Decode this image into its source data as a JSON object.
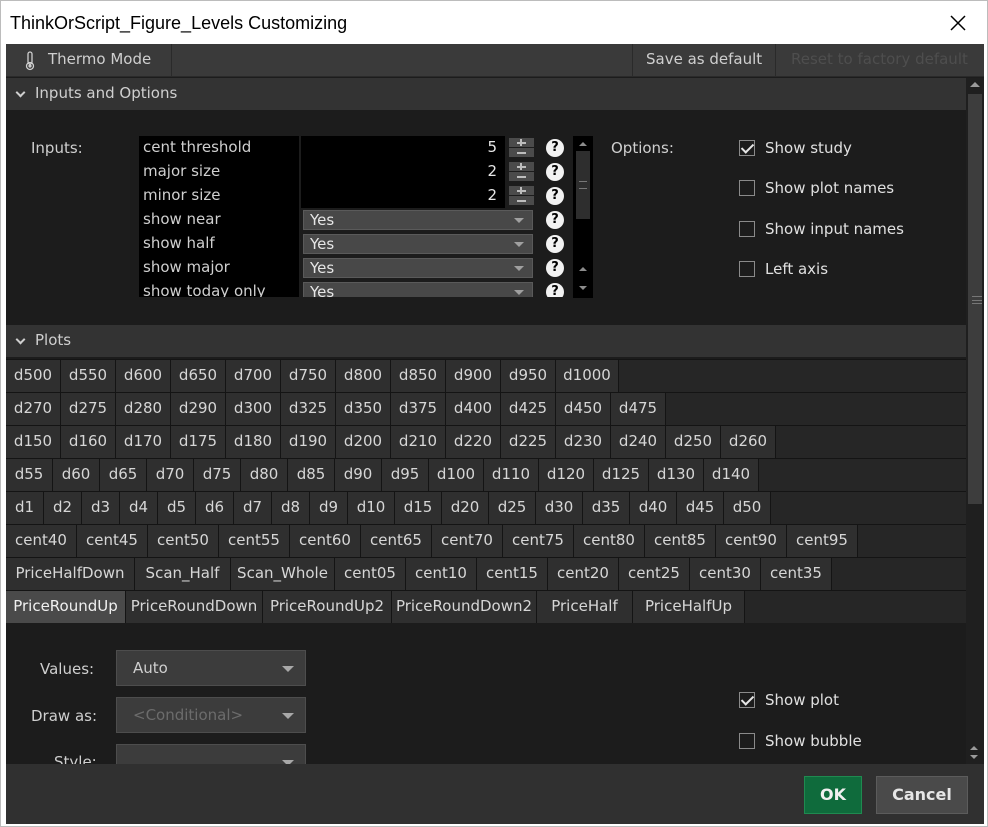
{
  "window": {
    "title": "ThinkOrScript_Figure_Levels Customizing"
  },
  "toolbar": {
    "thermo_label": "Thermo Mode",
    "save_default_label": "Save as default",
    "reset_default_label": "Reset to factory default"
  },
  "inputs_section": {
    "title": "Inputs and Options",
    "inputs_label": "Inputs:",
    "options_label": "Options:",
    "rows": [
      {
        "name": "cent threshold",
        "value": "5"
      },
      {
        "name": "major size",
        "value": "2"
      },
      {
        "name": "minor size",
        "value": "2"
      },
      {
        "name": "show near",
        "value": "Yes"
      },
      {
        "name": "show half",
        "value": "Yes"
      },
      {
        "name": "show major",
        "value": "Yes"
      },
      {
        "name": "show today only",
        "value": "Yes"
      }
    ],
    "help_glyph": "?",
    "options": [
      {
        "label": "Show study",
        "checked": true
      },
      {
        "label": "Show plot names",
        "checked": false
      },
      {
        "label": "Show input names",
        "checked": false
      },
      {
        "label": "Left axis",
        "checked": false
      }
    ]
  },
  "plots_section": {
    "title": "Plots",
    "rows": [
      [
        "d500",
        "d550",
        "d600",
        "d650",
        "d700",
        "d750",
        "d800",
        "d850",
        "d900",
        "d950",
        "d1000"
      ],
      [
        "d270",
        "d275",
        "d280",
        "d290",
        "d300",
        "d325",
        "d350",
        "d375",
        "d400",
        "d425",
        "d450",
        "d475"
      ],
      [
        "d150",
        "d160",
        "d170",
        "d175",
        "d180",
        "d190",
        "d200",
        "d210",
        "d220",
        "d225",
        "d230",
        "d240",
        "d250",
        "d260"
      ],
      [
        "d55",
        "d60",
        "d65",
        "d70",
        "d75",
        "d80",
        "d85",
        "d90",
        "d95",
        "d100",
        "d110",
        "d120",
        "d125",
        "d130",
        "d140"
      ],
      [
        "d1",
        "d2",
        "d3",
        "d4",
        "d5",
        "d6",
        "d7",
        "d8",
        "d9",
        "d10",
        "d15",
        "d20",
        "d25",
        "d30",
        "d35",
        "d40",
        "d45",
        "d50"
      ],
      [
        "cent40",
        "cent45",
        "cent50",
        "cent55",
        "cent60",
        "cent65",
        "cent70",
        "cent75",
        "cent80",
        "cent85",
        "cent90",
        "cent95"
      ],
      [
        "PriceHalfDown",
        "Scan_Half",
        "Scan_Whole",
        "cent05",
        "cent10",
        "cent15",
        "cent20",
        "cent25",
        "cent30",
        "cent35"
      ],
      [
        "PriceRoundUp",
        "PriceRoundDown",
        "PriceRoundUp2",
        "PriceRoundDown2",
        "PriceHalf",
        "PriceHalfUp"
      ]
    ],
    "selected": "PriceRoundUp"
  },
  "plot_settings": {
    "values_label": "Values:",
    "values_value": "Auto",
    "draw_as_label": "Draw as:",
    "draw_as_value": "<Conditional>",
    "style_label": "Style:",
    "show_plot": {
      "label": "Show plot",
      "checked": true
    },
    "show_bubble": {
      "label": "Show bubble",
      "checked": false
    }
  },
  "footer": {
    "ok_label": "OK",
    "cancel_label": "Cancel"
  },
  "colors": {
    "ok_green": "#0f6b3c",
    "panel_dark": "#1c1c1c",
    "header_gray": "#333333"
  }
}
